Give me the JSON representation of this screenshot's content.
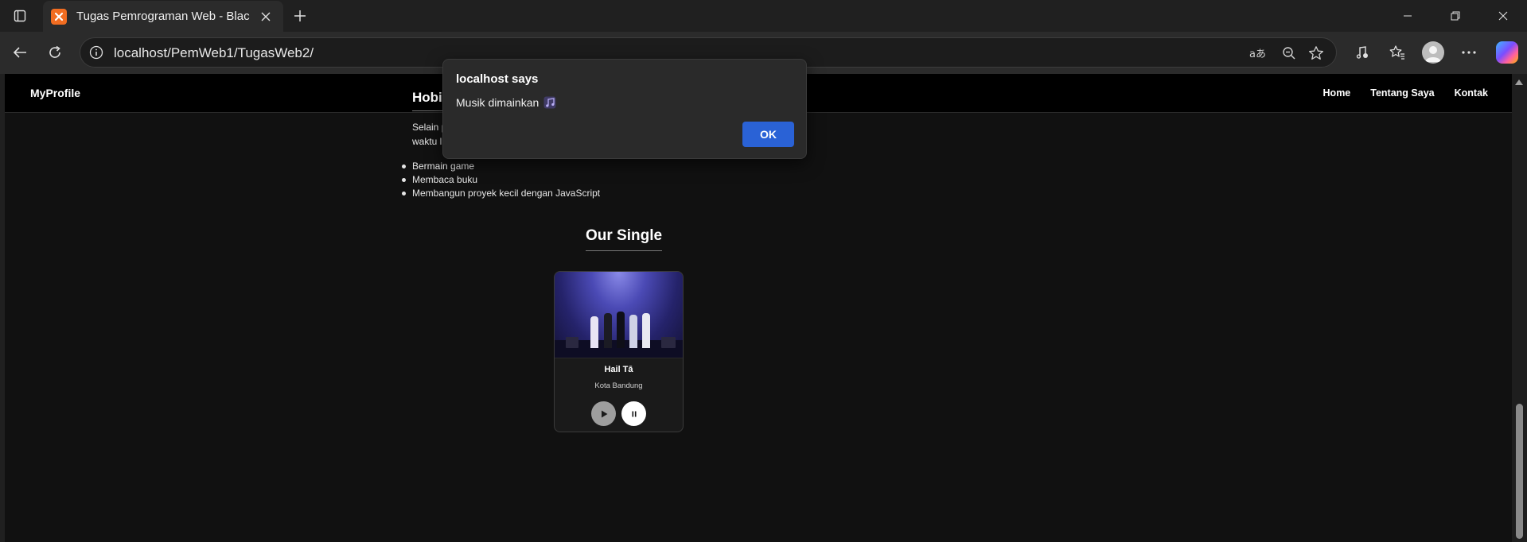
{
  "browser": {
    "tab_title": "Tugas Pemrograman Web - Black",
    "url": "localhost/PemWeb1/TugasWeb2/"
  },
  "site": {
    "brand": "MyProfile",
    "nav": [
      "Home",
      "Tentang Saya",
      "Kontak"
    ]
  },
  "hobi": {
    "title": "Hobi",
    "text_line1": "Selain p",
    "text_line2": "waktu lu",
    "items": [
      "Bermain game",
      "Membaca buku",
      "Membangun proyek kecil dengan JavaScript"
    ]
  },
  "single": {
    "title": "Our Single",
    "song_title": "Hail Tā",
    "song_subtitle": "Kota Bandung"
  },
  "dialog": {
    "title": "localhost says",
    "message": "Musik dimainkan",
    "ok_label": "OK"
  },
  "colors": {
    "page_bg": "#111111",
    "ok_button": "#2a62d6",
    "favicon": "#f26d21"
  }
}
